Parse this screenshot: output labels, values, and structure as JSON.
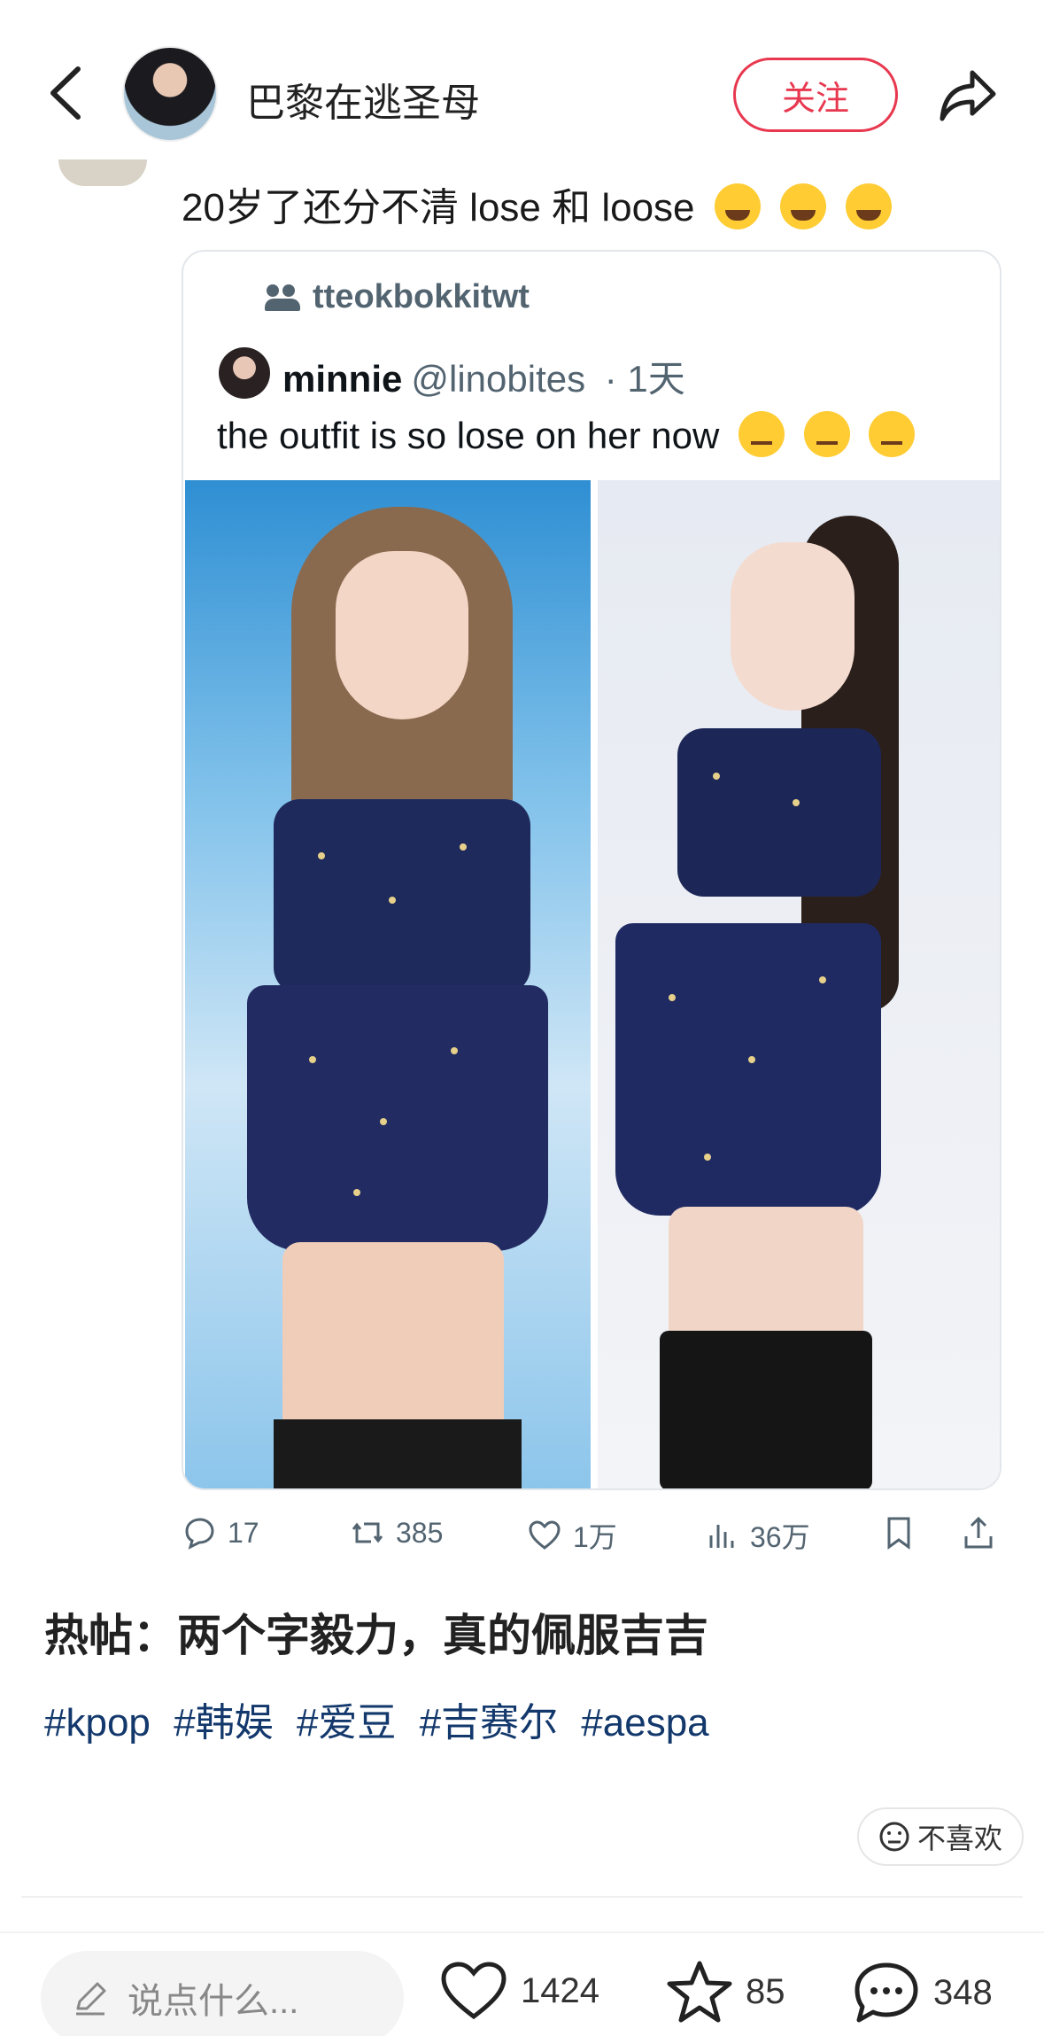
{
  "header": {
    "author_name": "巴黎在逃圣母",
    "follow_label": "关注"
  },
  "tweet": {
    "text": "20岁了还分不清 lose 和 loose",
    "emojis": [
      "loudly-crying-face",
      "loudly-crying-face",
      "loudly-crying-face"
    ],
    "quote": {
      "repost_user": "tteokbokkitwt",
      "display_name": "minnie",
      "handle": "@linobites",
      "time": "· 1天",
      "text": "the outfit is so lose on her now",
      "emojis": [
        "flushed-sad-face",
        "flushed-sad-face",
        "flushed-sad-face"
      ]
    },
    "actions": {
      "replies": "17",
      "retweets": "385",
      "likes": "1万",
      "views": "36万"
    }
  },
  "post": {
    "title": "热帖：两个字毅力，真的佩服吉吉",
    "tags": [
      "#kpop",
      "#韩娱",
      "#爱豆",
      "#吉赛尔",
      "#aespa"
    ],
    "dislike_label": "不喜欢"
  },
  "bottom_bar": {
    "comment_placeholder": "说点什么...",
    "likes": "1424",
    "favorites": "85",
    "comments": "348"
  },
  "colors": {
    "accent_red": "#e8384f",
    "tag_blue": "#13386c",
    "twitter_gray": "#536471"
  }
}
